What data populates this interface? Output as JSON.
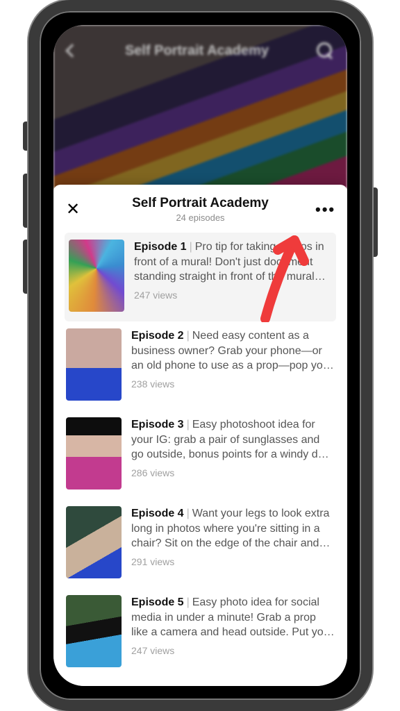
{
  "hero": {
    "back_aria": "Back",
    "title": "Self Portrait Academy",
    "search_aria": "Search"
  },
  "sheet": {
    "close_aria": "Close",
    "title": "Self Portrait Academy",
    "subtitle": "24 episodes",
    "more_aria": "More options"
  },
  "episodes": [
    {
      "label": "Episode 1",
      "desc": "Pro tip for taking photos in front of a mural! Don't just document standing straight in front of the mural—…",
      "views": "247 views"
    },
    {
      "label": "Episode 2",
      "desc": "Need easy content as a business owner? Grab your phone—or an old phone to use as a prop—pop yo…",
      "views": "238 views"
    },
    {
      "label": "Episode 3",
      "desc": "Easy photoshoot idea for your IG: grab a pair of sunglasses and go outside, bonus points for a windy d…",
      "views": "286 views"
    },
    {
      "label": "Episode 4",
      "desc": "Want your legs to look extra long in photos where you're sitting in a chair? Sit on the edge of the chair and…",
      "views": "291 views"
    },
    {
      "label": "Episode 5",
      "desc": "Easy photo idea for social media in under a minute! Grab a prop like a camera and head outside. Put yo…",
      "views": "247 views"
    }
  ],
  "annotation": {
    "arrow_target": "more-options-button"
  }
}
